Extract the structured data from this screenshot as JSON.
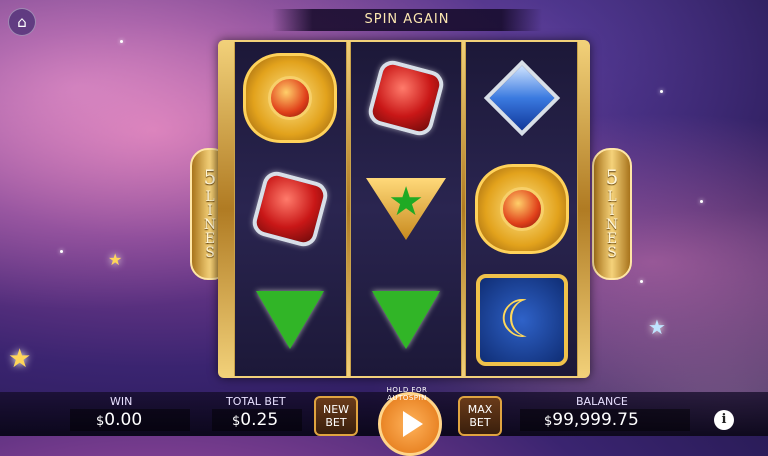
{
  "banner": {
    "text": "SPIN AGAIN"
  },
  "lines": {
    "number": "5",
    "word": "LINES"
  },
  "reels": [
    [
      "Sun Medallion",
      "Red Gem",
      "Green Gem"
    ],
    [
      "Red Gem",
      "Emerald Star Badge",
      "Green Gem"
    ],
    [
      "Blue Gem",
      "Sun Medallion",
      "Moon Tile"
    ]
  ],
  "bottom_bar": {
    "win_label": "WIN",
    "win_currency": "$",
    "win_value": "0.00",
    "total_bet_label": "TOTAL BET",
    "total_bet_currency": "$",
    "total_bet_value": "0.25",
    "new_bet_label": "NEW BET",
    "autospin_hint": "HOLD FOR AUTOSPIN",
    "max_bet_label": "MAX BET",
    "balance_label": "BALANCE",
    "balance_currency": "$",
    "balance_value": "99,999.75",
    "info_label": "i"
  },
  "icons": {
    "home": "home-icon",
    "spin": "play-arrow-icon",
    "info": "info-icon"
  }
}
